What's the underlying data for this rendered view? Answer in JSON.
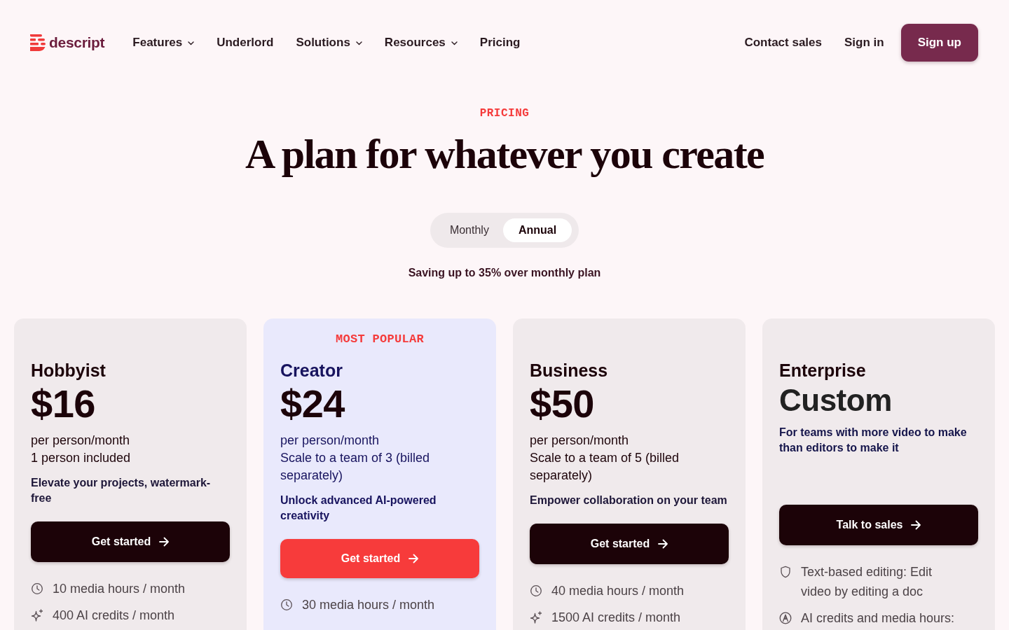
{
  "header": {
    "brand": "descript",
    "nav": [
      {
        "label": "Features",
        "dropdown": true
      },
      {
        "label": "Underlord",
        "dropdown": false
      },
      {
        "label": "Solutions",
        "dropdown": true
      },
      {
        "label": "Resources",
        "dropdown": true
      },
      {
        "label": "Pricing",
        "dropdown": false
      }
    ],
    "actions": [
      {
        "label": "Contact sales",
        "kind": "link"
      },
      {
        "label": "Sign in",
        "kind": "link"
      },
      {
        "label": "Sign up",
        "kind": "primary"
      }
    ]
  },
  "hero": {
    "eyebrow": "PRICING",
    "title": "A plan for whatever you create",
    "billing": [
      {
        "label": "Monthly",
        "selected": false
      },
      {
        "label": "Annual",
        "selected": true
      }
    ],
    "note": "Saving up to 35% over monthly plan"
  },
  "plans": [
    {
      "kind": "fixed",
      "featured": false,
      "name": "Hobbyist",
      "price": "$16",
      "details": [
        "per person/month",
        "1 person included"
      ],
      "tagline": "Elevate your projects, watermark-free",
      "button": "Get started",
      "features": [
        {
          "kind": "hours",
          "text": "10 media hours / month"
        },
        {
          "kind": "credits",
          "text": "400 AI credits / month"
        }
      ]
    },
    {
      "kind": "fixed",
      "featured": true,
      "badge": "MOST POPULAR",
      "name": "Creator",
      "price": "$24",
      "details": [
        "per person/month",
        "Scale to a team of 3 (billed separately)"
      ],
      "tagline": "Unlock advanced AI-powered creativity",
      "button": "Get started",
      "features": [
        {
          "kind": "hours",
          "text": "30 media hours / month"
        }
      ]
    },
    {
      "kind": "fixed",
      "featured": false,
      "name": "Business",
      "price": "$50",
      "details": [
        "per person/month",
        "Scale to a team of 5 (billed separately)"
      ],
      "tagline": "Empower collaboration on your team",
      "button": "Get started",
      "features": [
        {
          "kind": "hours",
          "text": "40 media hours / month"
        },
        {
          "kind": "credits",
          "text": "1500 AI credits / month"
        }
      ]
    },
    {
      "kind": "custom",
      "featured": false,
      "name": "Enterprise",
      "price": "Custom",
      "tagline": "For teams with more video to make than editors to make it",
      "button": "Talk to sales",
      "features": [
        {
          "kind": "editing",
          "text": "Text-based editing: Edit video by editing a doc"
        },
        {
          "kind": "bundle",
          "text": "AI credits and media hours:"
        }
      ]
    }
  ]
}
